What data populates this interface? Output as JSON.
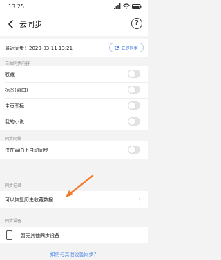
{
  "status_bar": {
    "time": "13:25"
  },
  "header": {
    "back_icon": "chevron-left-icon",
    "title": "云同步",
    "help_glyph": "?"
  },
  "sync": {
    "last_sync": "最近同步：2020-03-11 13:21",
    "sync_now_label": "立即同步"
  },
  "sections": {
    "auto_sync": {
      "header": "自动同步内容",
      "items": [
        {
          "label": "收藏",
          "enabled": false
        },
        {
          "label": "标签(窗口)",
          "enabled": false
        },
        {
          "label": "主页图标",
          "enabled": false
        },
        {
          "label": "我的小说",
          "enabled": false
        }
      ]
    },
    "sync_network": {
      "header": "同步网络",
      "items": [
        {
          "label": "仅在WiFi下自动同步",
          "enabled": false
        }
      ]
    },
    "sync_records": {
      "header": "同步记录",
      "items": [
        {
          "label": "可以恢复历史收藏数据"
        }
      ]
    },
    "sync_devices": {
      "header": "同步设备",
      "empty_text": "暂无其他同步设备"
    }
  },
  "footer": {
    "link": "如何与其他设备同步？"
  },
  "colors": {
    "accent": "#3d7be0",
    "arrow": "#f07a2d",
    "toggle_off": "#e2e2e2"
  }
}
